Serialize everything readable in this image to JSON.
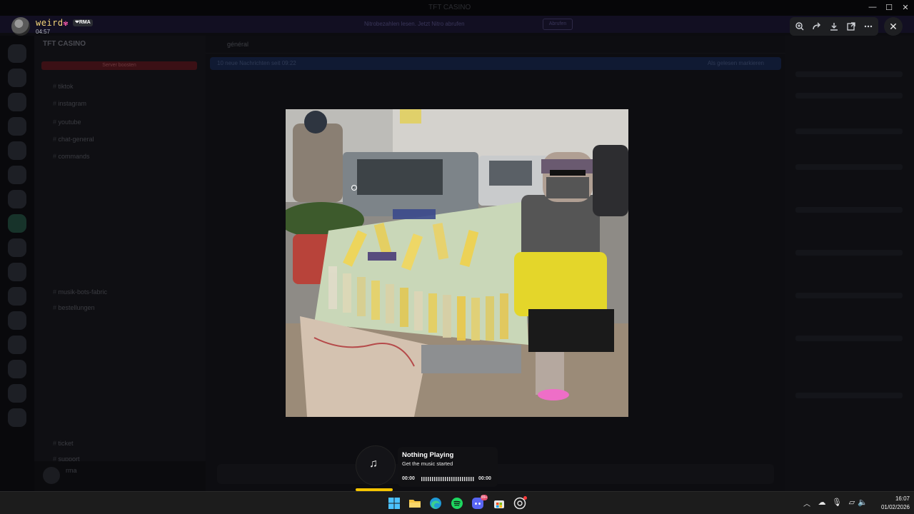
{
  "window": {
    "title": "TFT CASINO",
    "controls": {
      "minimize": "—",
      "maximize": "☐",
      "close": "✕"
    }
  },
  "notice": {
    "message": "Nitrobezahlen lesen. Jetzt Nitro abrufen",
    "button": "Abrufen"
  },
  "viewer": {
    "author": "weird",
    "author_deco": "✾",
    "badge": "❤RMA",
    "timestamp": "04:57",
    "toolbar_icons": [
      "zoom-in-icon",
      "forward-icon",
      "download-icon",
      "open-in-browser-icon",
      "more-icon"
    ],
    "close_icon": "✕"
  },
  "background": {
    "guild_name": "TFT CASINO",
    "boost_label": "Server boosten",
    "channels": [
      "tiktok",
      "instagram",
      "youtube",
      "chat-general",
      "commands",
      "musik-bots-fabric",
      "bestellungen",
      "ticket",
      "support"
    ],
    "chat_channel": "général",
    "unread_text": "10 neue Nachrichten seit 09:22",
    "unread_mark": "Als gelesen markieren",
    "user_name": "rma"
  },
  "music": {
    "title": "Nothing Playing",
    "subtitle": "Get the music started",
    "time_start": "00:00",
    "time_end": "00:00",
    "progress": 0.0
  },
  "taskbar": {
    "apps": [
      "windows-start-icon",
      "file-explorer-icon",
      "edge-icon",
      "spotify-icon",
      "discord-icon",
      "store-icon",
      "chrome-icon"
    ],
    "discord_badge": "99+",
    "tray_icons": [
      "chevron-up-icon",
      "onedrive-icon",
      "microphone-icon",
      "wifi-icon",
      "display-icon",
      "volume-icon"
    ],
    "time": "16:07",
    "date": "01/02/2026"
  }
}
